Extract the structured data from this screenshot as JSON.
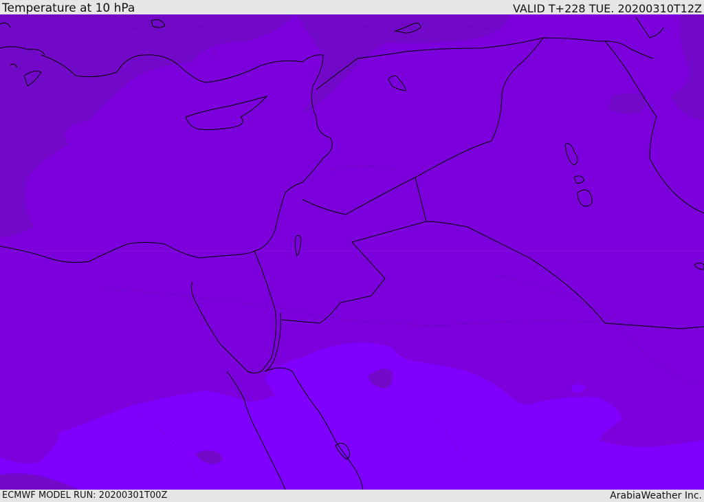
{
  "header": {
    "title": "Temperature at 10 hPa",
    "valid": "VALID T+228 TUE. 20200310T12Z"
  },
  "footer": {
    "model_run": "ECMWF MODEL RUN: 20200301T00Z",
    "credit": "ArabiaWeather Inc."
  },
  "map": {
    "colors": {
      "dark_fill": "#7208c8",
      "mid_fill": "#7c00dc",
      "light_fill": "#7f00ff",
      "coastline": "#000000"
    }
  }
}
